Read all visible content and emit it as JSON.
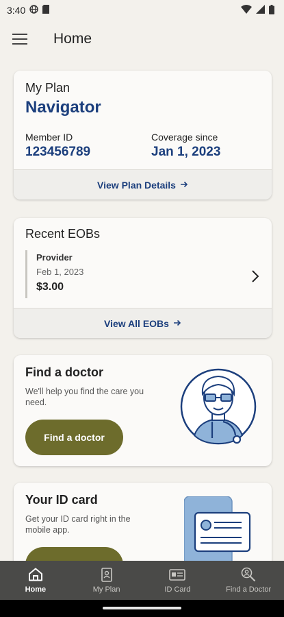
{
  "status_bar": {
    "time": "3:40"
  },
  "app_bar": {
    "title": "Home"
  },
  "plan_card": {
    "label": "My Plan",
    "plan_name": "Navigator",
    "member_id_label": "Member ID",
    "member_id": "123456789",
    "coverage_label": "Coverage since",
    "coverage_date": "Jan 1, 2023",
    "details_link": "View Plan Details"
  },
  "eob_card": {
    "title": "Recent EOBs",
    "items": [
      {
        "provider": "Provider",
        "date": "Feb 1, 2023",
        "amount": "$3.00"
      }
    ],
    "view_all_link": "View All EOBs"
  },
  "doctor_card": {
    "title": "Find a doctor",
    "subtitle": "We'll help you find the care you need.",
    "button": "Find a doctor"
  },
  "id_card": {
    "title": "Your ID card",
    "subtitle": "Get your ID card right in the mobile app."
  },
  "bottom_nav": {
    "items": [
      {
        "label": "Home",
        "icon": "home-icon"
      },
      {
        "label": "My Plan",
        "icon": "document-icon"
      },
      {
        "label": "ID Card",
        "icon": "id-card-icon"
      },
      {
        "label": "Find a Doctor",
        "icon": "search-person-icon"
      }
    ]
  },
  "colors": {
    "primary": "#1c3f7d",
    "button": "#6d6c2c",
    "nav_bg": "#4a4a48",
    "page_bg": "#f3f1ec"
  }
}
